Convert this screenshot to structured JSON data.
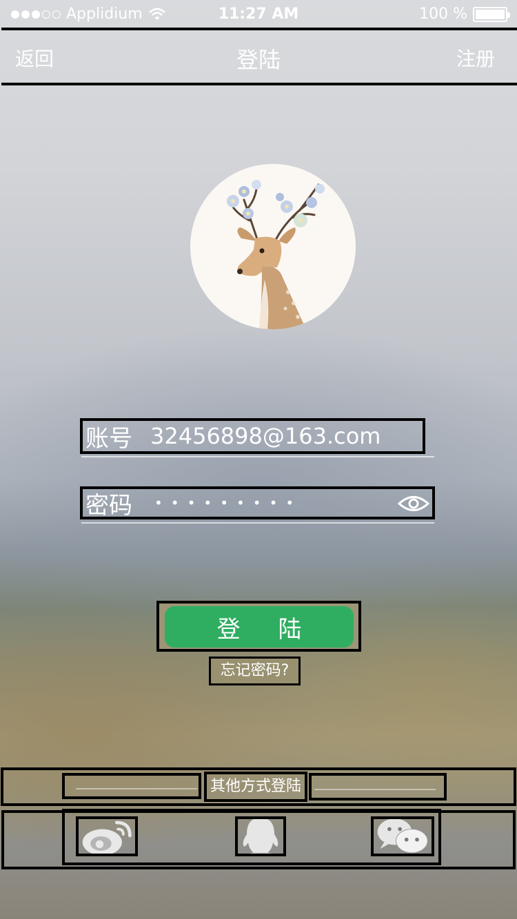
{
  "status_bar": {
    "carrier": "Applidium",
    "time": "11:27 AM",
    "battery": "100 %",
    "signal_filled": 3,
    "signal_total": 5
  },
  "nav": {
    "back": "返回",
    "title": "登陆",
    "register": "注册"
  },
  "avatar": {
    "description_icon": "deer-avatar-icon"
  },
  "form": {
    "account_label": "账号",
    "account_value": "32456898@163.com",
    "password_label": "密码",
    "password_masked": "•••••••••"
  },
  "login_button": "登 陆",
  "forgot_password": "忘记密码?",
  "other_login": {
    "label": "其他方式登陆",
    "icons": [
      "weibo-icon",
      "qq-icon",
      "wechat-icon"
    ]
  },
  "colors": {
    "login_green": "#2fae62",
    "outline": "#000000",
    "text": "#ffffff"
  }
}
